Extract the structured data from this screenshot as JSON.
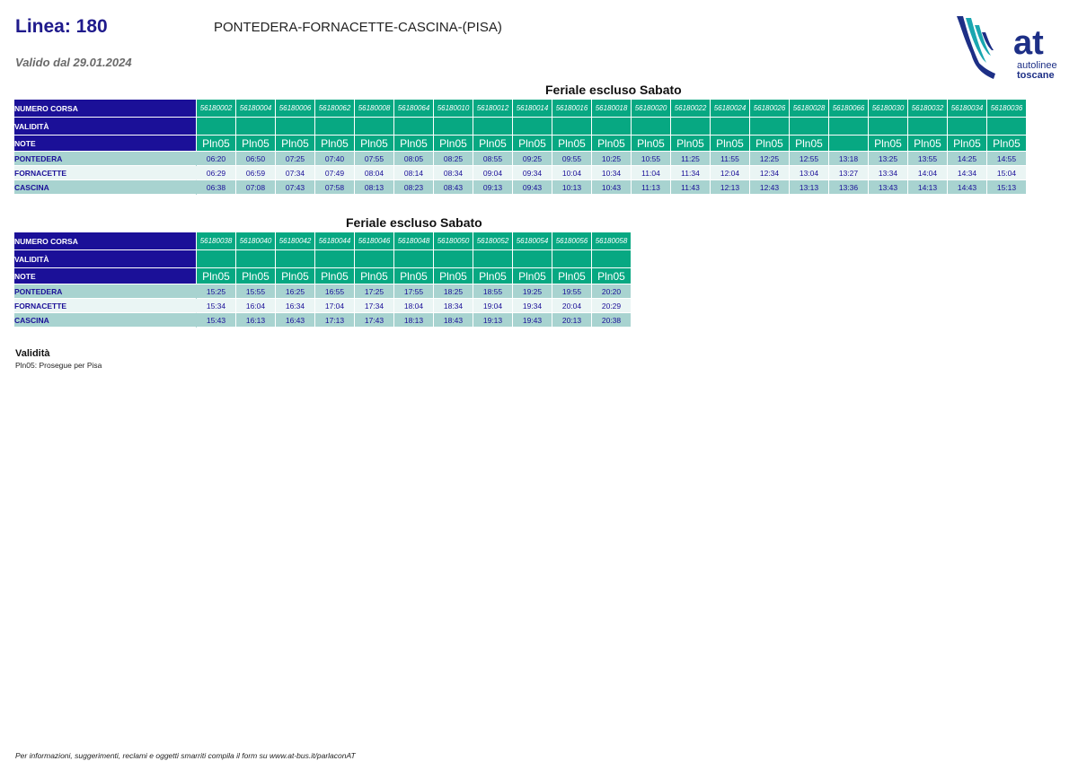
{
  "header": {
    "line_title": "Linea: 180",
    "route": "PONTEDERA-FORNACETTE-CASCINA-(PISA)",
    "valid_from": "Valido dal 29.01.2024"
  },
  "logo": {
    "mark": "at",
    "line1": "autolinee",
    "line2": "toscane",
    "colors": {
      "blue": "#1d2f86",
      "teal": "#1aa6b0"
    }
  },
  "row_labels": {
    "run_number": "NUMERO CORSA",
    "validity": "VALIDITÀ",
    "notes": "NOTE"
  },
  "colors": {
    "header_blue": "#1b1098",
    "header_green": "#07a882",
    "band_dark": "#a8d3d0",
    "band_light": "#eaf5f4"
  },
  "tables": [
    {
      "title": "Feriale escluso Sabato",
      "runs": [
        "56180002",
        "56180004",
        "56180006",
        "56180062",
        "56180008",
        "56180064",
        "56180010",
        "56180012",
        "56180014",
        "56180016",
        "56180018",
        "56180020",
        "56180022",
        "56180024",
        "56180026",
        "56180028",
        "56180066",
        "56180030",
        "56180032",
        "56180034",
        "56180036"
      ],
      "notes": [
        "Pln05",
        "Pln05",
        "Pln05",
        "Pln05",
        "Pln05",
        "Pln05",
        "Pln05",
        "Pln05",
        "Pln05",
        "Pln05",
        "Pln05",
        "Pln05",
        "Pln05",
        "Pln05",
        "Pln05",
        "Pln05",
        "",
        "Pln05",
        "Pln05",
        "Pln05",
        "Pln05"
      ],
      "stops": [
        {
          "name": "PONTEDERA",
          "times": [
            "06:20",
            "06:50",
            "07:25",
            "07:40",
            "07:55",
            "08:05",
            "08:25",
            "08:55",
            "09:25",
            "09:55",
            "10:25",
            "10:55",
            "11:25",
            "11:55",
            "12:25",
            "12:55",
            "13:18",
            "13:25",
            "13:55",
            "14:25",
            "14:55"
          ]
        },
        {
          "name": "FORNACETTE",
          "times": [
            "06:29",
            "06:59",
            "07:34",
            "07:49",
            "08:04",
            "08:14",
            "08:34",
            "09:04",
            "09:34",
            "10:04",
            "10:34",
            "11:04",
            "11:34",
            "12:04",
            "12:34",
            "13:04",
            "13:27",
            "13:34",
            "14:04",
            "14:34",
            "15:04"
          ]
        },
        {
          "name": "CASCINA",
          "times": [
            "06:38",
            "07:08",
            "07:43",
            "07:58",
            "08:13",
            "08:23",
            "08:43",
            "09:13",
            "09:43",
            "10:13",
            "10:43",
            "11:13",
            "11:43",
            "12:13",
            "12:43",
            "13:13",
            "13:36",
            "13:43",
            "14:13",
            "14:43",
            "15:13"
          ]
        }
      ]
    },
    {
      "title": "Feriale escluso Sabato",
      "runs": [
        "56180038",
        "56180040",
        "56180042",
        "56180044",
        "56180046",
        "56180048",
        "56180050",
        "56180052",
        "56180054",
        "56180056",
        "56180058"
      ],
      "notes": [
        "Pln05",
        "Pln05",
        "Pln05",
        "Pln05",
        "Pln05",
        "Pln05",
        "Pln05",
        "Pln05",
        "Pln05",
        "Pln05",
        "Pln05"
      ],
      "stops": [
        {
          "name": "PONTEDERA",
          "times": [
            "15:25",
            "15:55",
            "16:25",
            "16:55",
            "17:25",
            "17:55",
            "18:25",
            "18:55",
            "19:25",
            "19:55",
            "20:20"
          ]
        },
        {
          "name": "FORNACETTE",
          "times": [
            "15:34",
            "16:04",
            "16:34",
            "17:04",
            "17:34",
            "18:04",
            "18:34",
            "19:04",
            "19:34",
            "20:04",
            "20:29"
          ]
        },
        {
          "name": "CASCINA",
          "times": [
            "15:43",
            "16:13",
            "16:43",
            "17:13",
            "17:43",
            "18:13",
            "18:43",
            "19:13",
            "19:43",
            "20:13",
            "20:38"
          ]
        }
      ]
    }
  ],
  "legend": {
    "title": "Validità",
    "text": "Pln05: Prosegue per Pisa"
  },
  "footer": "Per informazioni, suggerimenti, reclami e oggetti smarriti compila il form su  www.at-bus.it/parlaconAT"
}
